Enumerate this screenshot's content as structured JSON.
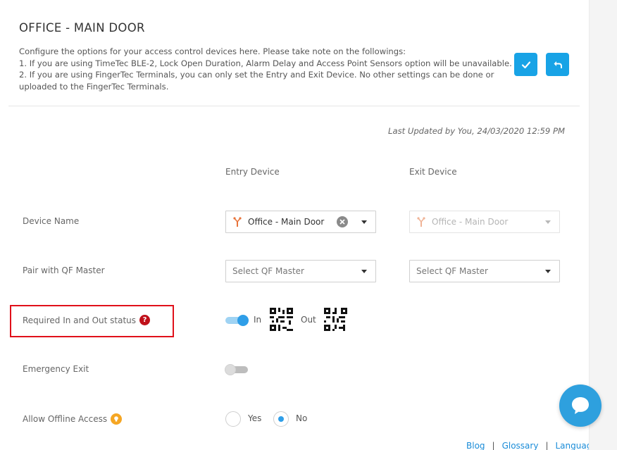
{
  "page": {
    "title": "OFFICE - MAIN DOOR",
    "description_lines": [
      "Configure the options for your access control devices here. Please take note on the followings:",
      "1. If you are using TimeTec BLE-2, Lock Open Duration, Alarm Delay and Access Point Sensors option will be unavailable.",
      "2. If you are using FingerTec Terminals, you can only set the Entry and Exit Device. No other settings can be done or",
      "uploaded to the FingerTec Terminals."
    ],
    "last_updated": "Last Updated by You, 24/03/2020 12:59 PM"
  },
  "buttons": {
    "save_icon": "check-icon",
    "back_icon": "undo-arrow-icon"
  },
  "columns": {
    "entry": "Entry Device",
    "exit": "Exit Device"
  },
  "fields": {
    "device_name": {
      "label": "Device Name",
      "entry_value": "Office - Main Door",
      "exit_value": "Office - Main Door"
    },
    "pair_qf": {
      "label": "Pair with QF Master",
      "entry_placeholder": "Select QF Master",
      "exit_placeholder": "Select QF Master"
    },
    "required_status": {
      "label": "Required In and Out status",
      "help_icon": "?",
      "enabled": true,
      "in_label": "In",
      "out_label": "Out"
    },
    "emergency_exit": {
      "label": "Emergency Exit",
      "enabled": false
    },
    "offline_access": {
      "label": "Allow Offline Access",
      "yes_label": "Yes",
      "no_label": "No",
      "selected": "No"
    }
  },
  "footer": {
    "links": [
      "Blog",
      "Glossary",
      "Language"
    ]
  },
  "colors": {
    "accent": "#18a3e6",
    "highlight_border": "#e0101a",
    "device_icon": "#e8743b"
  }
}
